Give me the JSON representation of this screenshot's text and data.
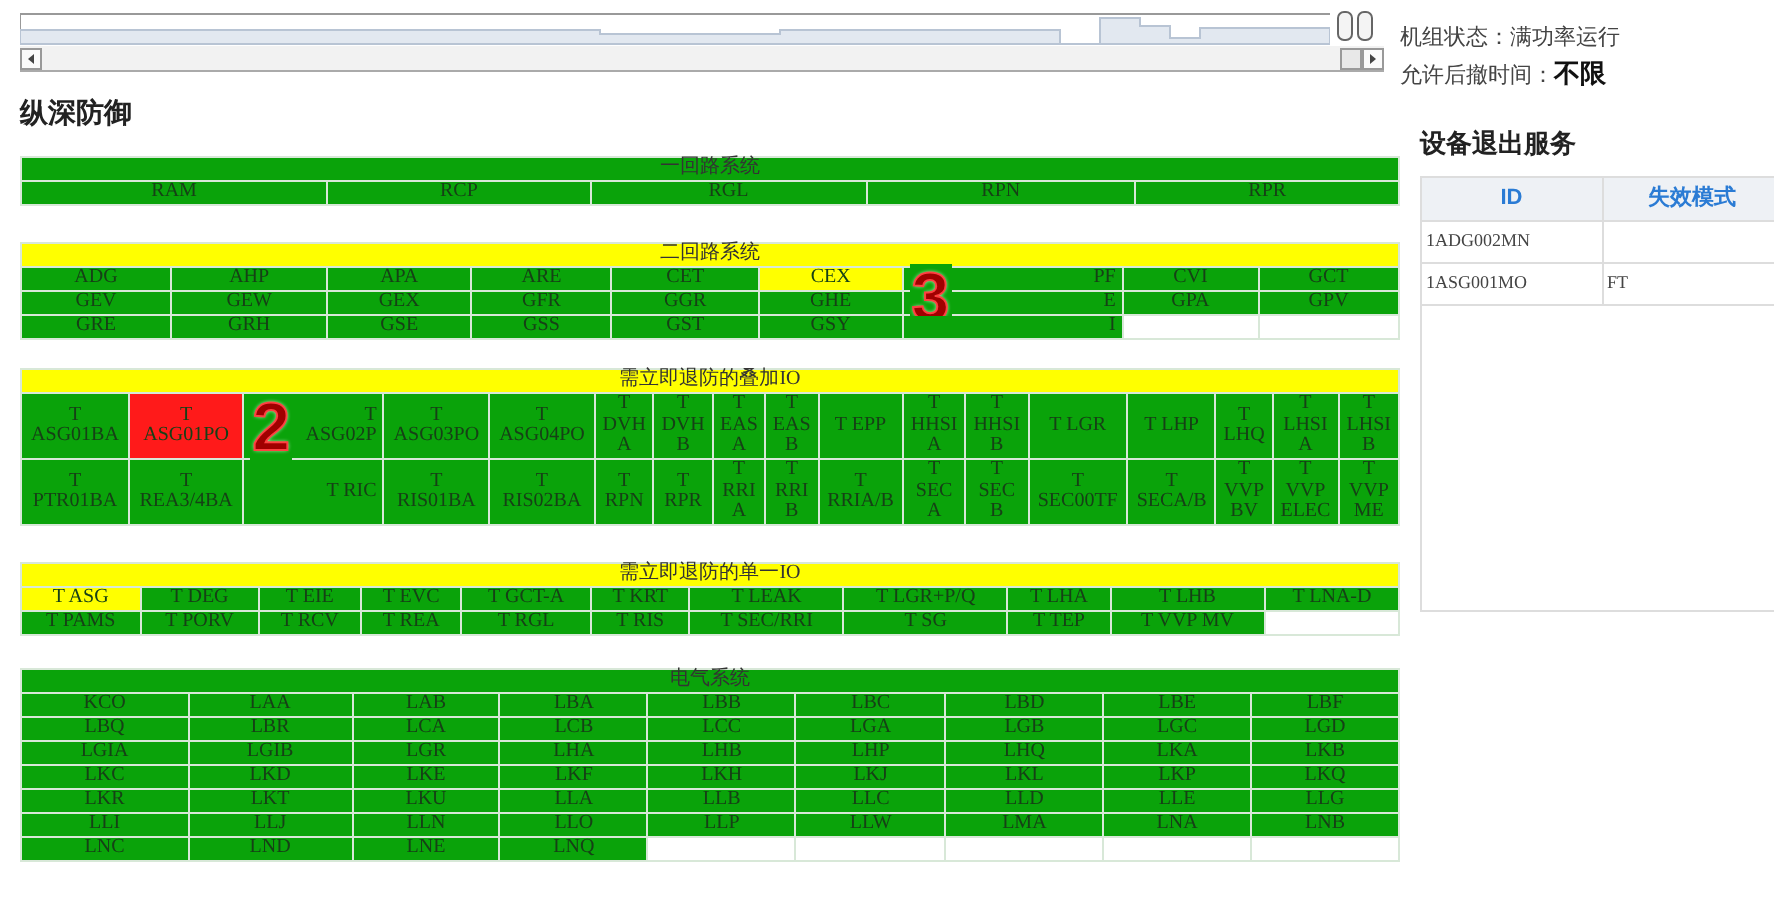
{
  "status": {
    "unit_label": "机组状态：",
    "unit_value": "满功率运行",
    "time_label": "允许后撤时间：",
    "time_value": "不限"
  },
  "page_title": "纵深防御",
  "blocks": [
    {
      "title": "一回路系统",
      "color": "#0aa30a",
      "rows": [
        [
          {
            "text": "RAM",
            "color": "#0aa30a"
          },
          {
            "text": "RCP",
            "color": "#0aa30a"
          },
          {
            "text": "RGL",
            "color": "#0aa30a"
          },
          {
            "text": "RPN",
            "color": "#0aa30a"
          },
          {
            "text": "RPR",
            "color": "#0aa30a"
          }
        ]
      ]
    },
    {
      "title": "二回路系统",
      "color": "#ffff00",
      "rows": [
        [
          {
            "text": "ADG",
            "color": "#0aa30a"
          },
          {
            "text": "AHP",
            "color": "#0aa30a"
          },
          {
            "text": "APA",
            "color": "#0aa30a"
          },
          {
            "text": "ARE",
            "color": "#0aa30a"
          },
          {
            "text": "CET",
            "color": "#0aa30a"
          },
          {
            "text": "CEX",
            "color": "#ffff00"
          },
          {
            "text": "PF",
            "color": "#0aa30a"
          },
          {
            "text": "CVI",
            "color": "#0aa30a"
          },
          {
            "text": "GCT",
            "color": "#0aa30a"
          }
        ],
        [
          {
            "text": "GEV",
            "color": "#0aa30a"
          },
          {
            "text": "GEW",
            "color": "#0aa30a"
          },
          {
            "text": "GEX",
            "color": "#0aa30a"
          },
          {
            "text": "GFR",
            "color": "#0aa30a"
          },
          {
            "text": "GGR",
            "color": "#0aa30a"
          },
          {
            "text": "GHE",
            "color": "#0aa30a"
          },
          {
            "text": "E",
            "color": "#0aa30a",
            "annotation": "3"
          },
          {
            "text": "GPA",
            "color": "#0aa30a"
          },
          {
            "text": "GPV",
            "color": "#0aa30a"
          }
        ],
        [
          {
            "text": "GRE",
            "color": "#0aa30a"
          },
          {
            "text": "GRH",
            "color": "#0aa30a"
          },
          {
            "text": "GSE",
            "color": "#0aa30a"
          },
          {
            "text": "GSS",
            "color": "#0aa30a"
          },
          {
            "text": "GST",
            "color": "#0aa30a"
          },
          {
            "text": "GSY",
            "color": "#0aa30a"
          },
          {
            "text": "I",
            "color": "#0aa30a"
          },
          {
            "color": "#ffffff"
          },
          {
            "color": "#ffffff"
          }
        ]
      ]
    },
    {
      "title": "需立即退防的叠加IO",
      "color": "#ffff00",
      "rows": [
        [
          {
            "text": "T\nASG01BA",
            "color": "#0aa30a"
          },
          {
            "text": "T\nASG01PO",
            "color": "#ff1a1a"
          },
          {
            "text": "T\nASG02P",
            "color": "#0aa30a",
            "annotation": "2"
          },
          {
            "text": "T\nASG03PO",
            "color": "#0aa30a"
          },
          {
            "text": "T\nASG04PO",
            "color": "#0aa30a"
          },
          {
            "text": "T\nDVH\nA",
            "color": "#0aa30a"
          },
          {
            "text": "T\nDVH\nB",
            "color": "#0aa30a"
          },
          {
            "text": "T\nEAS\nA",
            "color": "#0aa30a"
          },
          {
            "text": "T\nEAS\nB",
            "color": "#0aa30a"
          },
          {
            "text": "T EPP",
            "color": "#0aa30a"
          },
          {
            "text": "T\nHHSI\nA",
            "color": "#0aa30a"
          },
          {
            "text": "T\nHHSI\nB",
            "color": "#0aa30a"
          },
          {
            "text": "T LGR",
            "color": "#0aa30a"
          },
          {
            "text": "T LHP",
            "color": "#0aa30a"
          },
          {
            "text": "T\nLHQ",
            "color": "#0aa30a"
          },
          {
            "text": "T\nLHSI\nA",
            "color": "#0aa30a"
          },
          {
            "text": "T\nLHSI\nB",
            "color": "#0aa30a"
          }
        ],
        [
          {
            "text": "T\nPTR01BA",
            "color": "#0aa30a"
          },
          {
            "text": "T\nREA3/4BA",
            "color": "#0aa30a"
          },
          {
            "text": "T RIC",
            "color": "#0aa30a"
          },
          {
            "text": "T\nRIS01BA",
            "color": "#0aa30a"
          },
          {
            "text": "T\nRIS02BA",
            "color": "#0aa30a"
          },
          {
            "text": "T\nRPN",
            "color": "#0aa30a"
          },
          {
            "text": "T\nRPR",
            "color": "#0aa30a"
          },
          {
            "text": "T\nRRI\nA",
            "color": "#0aa30a"
          },
          {
            "text": "T\nRRI\nB",
            "color": "#0aa30a"
          },
          {
            "text": "T\nRRIA/B",
            "color": "#0aa30a"
          },
          {
            "text": "T\nSEC\nA",
            "color": "#0aa30a"
          },
          {
            "text": "T\nSEC\nB",
            "color": "#0aa30a"
          },
          {
            "text": "T\nSEC00TF",
            "color": "#0aa30a"
          },
          {
            "text": "T\nSECA/B",
            "color": "#0aa30a"
          },
          {
            "text": "T\nVVP\nBV",
            "color": "#0aa30a"
          },
          {
            "text": "T\nVVP\nELEC",
            "color": "#0aa30a"
          },
          {
            "text": "T\nVVP\nME",
            "color": "#0aa30a"
          }
        ]
      ]
    },
    {
      "title": "需立即退防的单一IO",
      "color": "#ffff00",
      "rows": [
        [
          {
            "text": "T ASG",
            "color": "#ffff00"
          },
          {
            "text": "T DEG",
            "color": "#0aa30a"
          },
          {
            "text": "T EIE",
            "color": "#0aa30a"
          },
          {
            "text": "T EVC",
            "color": "#0aa30a"
          },
          {
            "text": "T GCT-A",
            "color": "#0aa30a"
          },
          {
            "text": "T KRT",
            "color": "#0aa30a"
          },
          {
            "text": "T LEAK",
            "color": "#0aa30a"
          },
          {
            "text": "T LGR+P/Q",
            "color": "#0aa30a"
          },
          {
            "text": "T LHA",
            "color": "#0aa30a"
          },
          {
            "text": "T LHB",
            "color": "#0aa30a"
          },
          {
            "text": "T LNA-D",
            "color": "#0aa30a"
          }
        ],
        [
          {
            "text": "T PAMS",
            "color": "#0aa30a"
          },
          {
            "text": "T PORV",
            "color": "#0aa30a"
          },
          {
            "text": "T RCV",
            "color": "#0aa30a"
          },
          {
            "text": "T REA",
            "color": "#0aa30a"
          },
          {
            "text": "T RGL",
            "color": "#0aa30a"
          },
          {
            "text": "T RIS",
            "color": "#0aa30a"
          },
          {
            "text": "T SEC/RRI",
            "color": "#0aa30a"
          },
          {
            "text": "T SG",
            "color": "#0aa30a"
          },
          {
            "text": "T TEP",
            "color": "#0aa30a"
          },
          {
            "text": "T VVP MV",
            "color": "#0aa30a"
          },
          {
            "color": "#ffffff"
          }
        ]
      ]
    },
    {
      "title": "电气系统",
      "color": "#0aa30a",
      "rows": [
        [
          {
            "text": "KCO",
            "color": "#0aa30a"
          },
          {
            "text": "LAA",
            "color": "#0aa30a"
          },
          {
            "text": "LAB",
            "color": "#0aa30a"
          },
          {
            "text": "LBA",
            "color": "#0aa30a"
          },
          {
            "text": "LBB",
            "color": "#0aa30a"
          },
          {
            "text": "LBC",
            "color": "#0aa30a"
          },
          {
            "text": "LBD",
            "color": "#0aa30a"
          },
          {
            "text": "LBE",
            "color": "#0aa30a"
          },
          {
            "text": "LBF",
            "color": "#0aa30a"
          }
        ],
        [
          {
            "text": "LBQ",
            "color": "#0aa30a"
          },
          {
            "text": "LBR",
            "color": "#0aa30a"
          },
          {
            "text": "LCA",
            "color": "#0aa30a"
          },
          {
            "text": "LCB",
            "color": "#0aa30a"
          },
          {
            "text": "LCC",
            "color": "#0aa30a"
          },
          {
            "text": "LGA",
            "color": "#0aa30a"
          },
          {
            "text": "LGB",
            "color": "#0aa30a"
          },
          {
            "text": "LGC",
            "color": "#0aa30a"
          },
          {
            "text": "LGD",
            "color": "#0aa30a"
          }
        ],
        [
          {
            "text": "LGIA",
            "color": "#0aa30a"
          },
          {
            "text": "LGIB",
            "color": "#0aa30a"
          },
          {
            "text": "LGR",
            "color": "#0aa30a"
          },
          {
            "text": "LHA",
            "color": "#0aa30a"
          },
          {
            "text": "LHB",
            "color": "#0aa30a"
          },
          {
            "text": "LHP",
            "color": "#0aa30a"
          },
          {
            "text": "LHQ",
            "color": "#0aa30a"
          },
          {
            "text": "LKA",
            "color": "#0aa30a"
          },
          {
            "text": "LKB",
            "color": "#0aa30a"
          }
        ],
        [
          {
            "text": "LKC",
            "color": "#0aa30a"
          },
          {
            "text": "LKD",
            "color": "#0aa30a"
          },
          {
            "text": "LKE",
            "color": "#0aa30a"
          },
          {
            "text": "LKF",
            "color": "#0aa30a"
          },
          {
            "text": "LKH",
            "color": "#0aa30a"
          },
          {
            "text": "LKJ",
            "color": "#0aa30a"
          },
          {
            "text": "LKL",
            "color": "#0aa30a"
          },
          {
            "text": "LKP",
            "color": "#0aa30a"
          },
          {
            "text": "LKQ",
            "color": "#0aa30a"
          }
        ],
        [
          {
            "text": "LKR",
            "color": "#0aa30a"
          },
          {
            "text": "LKT",
            "color": "#0aa30a"
          },
          {
            "text": "LKU",
            "color": "#0aa30a"
          },
          {
            "text": "LLA",
            "color": "#0aa30a"
          },
          {
            "text": "LLB",
            "color": "#0aa30a"
          },
          {
            "text": "LLC",
            "color": "#0aa30a"
          },
          {
            "text": "LLD",
            "color": "#0aa30a"
          },
          {
            "text": "LLE",
            "color": "#0aa30a"
          },
          {
            "text": "LLG",
            "color": "#0aa30a"
          }
        ],
        [
          {
            "text": "LLI",
            "color": "#0aa30a"
          },
          {
            "text": "LLJ",
            "color": "#0aa30a"
          },
          {
            "text": "LLN",
            "color": "#0aa30a"
          },
          {
            "text": "LLO",
            "color": "#0aa30a"
          },
          {
            "text": "LLP",
            "color": "#0aa30a"
          },
          {
            "text": "LLW",
            "color": "#0aa30a"
          },
          {
            "text": "LMA",
            "color": "#0aa30a"
          },
          {
            "text": "LNA",
            "color": "#0aa30a"
          },
          {
            "text": "LNB",
            "color": "#0aa30a"
          }
        ],
        [
          {
            "text": "LNC",
            "color": "#0aa30a"
          },
          {
            "text": "LND",
            "color": "#0aa30a"
          },
          {
            "text": "LNE",
            "color": "#0aa30a"
          },
          {
            "text": "LNQ",
            "color": "#0aa30a"
          },
          {
            "color": "#ffffff"
          },
          {
            "color": "#ffffff"
          },
          {
            "color": "#ffffff"
          },
          {
            "color": "#ffffff"
          },
          {
            "color": "#ffffff"
          }
        ]
      ]
    }
  ],
  "out_of_service": {
    "title": "设备退出服务",
    "columns": [
      "ID",
      "失效模式"
    ],
    "rows": [
      [
        "1ADG002MN",
        ""
      ],
      [
        "1ASG001MO",
        "FT"
      ]
    ]
  }
}
